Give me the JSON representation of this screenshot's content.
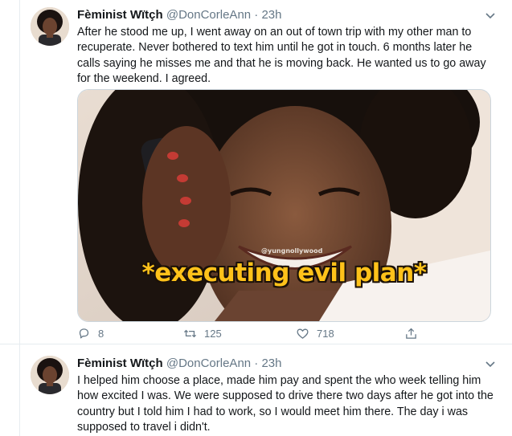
{
  "tweets": [
    {
      "name": "Fèminist Wïtçh",
      "handle": "@DonCorleAnn",
      "separator": "·",
      "time": "23h",
      "text": "After he stood me up, I went away on an out of town trip with my other man to recuperate. Never bothered to text him until he got in touch. 6 months later he calls saying he misses me and that he is moving back. He wanted us to go away for the weekend. I agreed.",
      "media": {
        "caption": "*executing evil plan*",
        "watermark": "@yungnollywood"
      },
      "actions": {
        "replies": "8",
        "retweets": "125",
        "likes": "718"
      },
      "icons": [
        "reply-icon",
        "retweet-icon",
        "like-icon",
        "share-icon",
        "chevron-down-icon"
      ]
    },
    {
      "name": "Fèminist Wïtçh",
      "handle": "@DonCorleAnn",
      "separator": "·",
      "time": "23h",
      "text": "I helped him choose a place, made him pay and spent the who week telling him how excited I was. We were supposed to drive there two days after he got into the country but I told him I had to work, so I would meet him there. The day i was supposed to travel i didn't."
    }
  ],
  "colors": {
    "text": "#14171a",
    "secondary": "#657786",
    "border": "#e6ecf0",
    "caption": "#ffc21a"
  }
}
